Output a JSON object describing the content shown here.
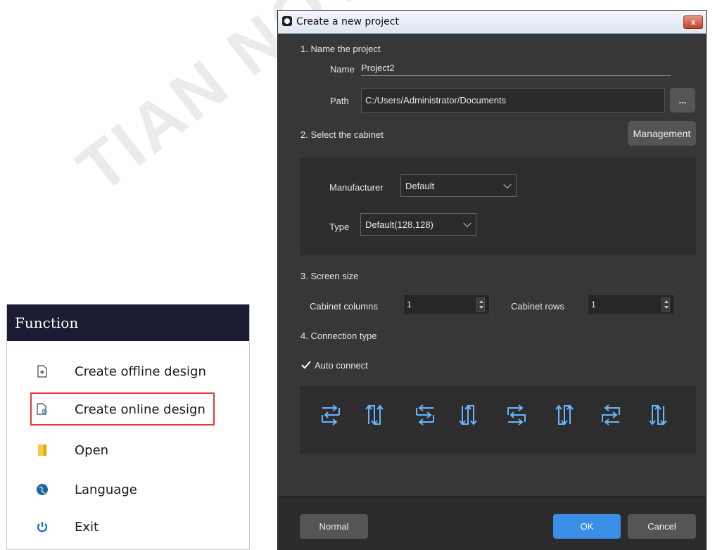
{
  "watermark": "TIAN NOVASTAR",
  "function_panel": {
    "title": "Function",
    "items": [
      {
        "label": "Create offline design",
        "icon": "new-file-icon"
      },
      {
        "label": "Create online design",
        "icon": "online-file-icon"
      },
      {
        "label": "Open",
        "icon": "folder-icon"
      },
      {
        "label": "Language",
        "icon": "globe-icon"
      },
      {
        "label": "Exit",
        "icon": "power-icon"
      }
    ],
    "highlight_color": "#e53935"
  },
  "dialog": {
    "title": "Create a new project",
    "close_label": "x",
    "section1": {
      "heading": "1. Name the project",
      "name_label": "Name",
      "name_value": "Project2",
      "path_label": "Path",
      "path_value": "C:/Users/Administrator/Documents",
      "browse_label": "..."
    },
    "section2": {
      "heading": "2. Select the cabinet",
      "management_label": "Management",
      "manufacturer_label": "Manufacturer",
      "manufacturer_value": "Default",
      "type_label": "Type",
      "type_value": "Default(128,128)"
    },
    "section3": {
      "heading": "3. Screen size",
      "columns_label": "Cabinet columns",
      "columns_value": "1",
      "rows_label": "Cabinet rows",
      "rows_value": "1"
    },
    "section4": {
      "heading": "4. Connection type",
      "auto_connect_label": "Auto connect",
      "auto_connect_checked": true,
      "connection_icons": [
        "snake-h-1-icon",
        "snake-v-1-icon",
        "snake-h-2-icon",
        "snake-v-2-icon",
        "snake-h-3-icon",
        "snake-v-3-icon",
        "snake-h-4-icon",
        "snake-v-4-icon"
      ]
    },
    "footer": {
      "normal_label": "Normal",
      "ok_label": "OK",
      "cancel_label": "Cancel"
    },
    "accent_color": "#3a8ee6",
    "connection_icon_color": "#6ab4ff"
  }
}
